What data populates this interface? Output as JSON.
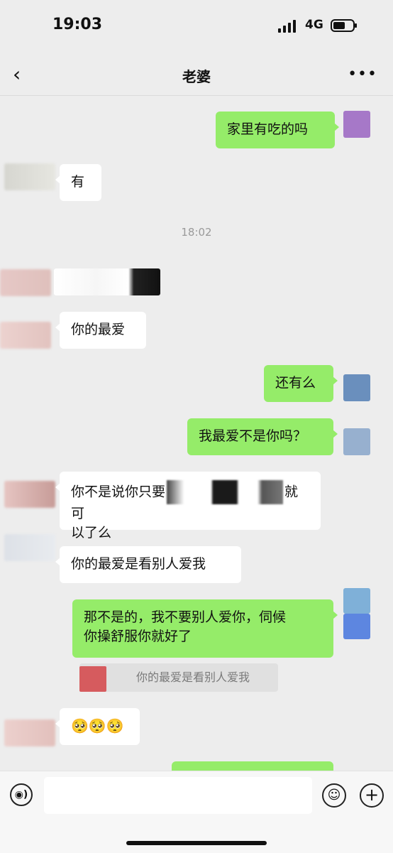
{
  "status": {
    "time": "19:03",
    "network": "4G"
  },
  "nav": {
    "back_icon": "‹",
    "title": "老婆",
    "more_icon": "•••"
  },
  "messages": [
    {
      "side": "right",
      "text": "家里有吃的吗"
    },
    {
      "side": "left",
      "text": "有"
    },
    {
      "side": "left",
      "text": "你的最爱"
    },
    {
      "side": "right",
      "text": "还有么"
    },
    {
      "side": "right",
      "text": "我最爱不是你吗？"
    },
    {
      "side": "left",
      "text": "你不是说你只要",
      "text_end": "就可",
      "text_line2": "以了么"
    },
    {
      "side": "left",
      "text": "你的最爱是看别人爱我"
    },
    {
      "side": "right",
      "text_line1": "那不是的，我不要别人爱你，伺候",
      "text_line2": "你操舒服你就好了"
    },
    {
      "side": "left",
      "text": "🥺🥺🥺"
    }
  ],
  "timestamp": "18:02",
  "quote": {
    "text": "你的最爱是看别人爱我"
  },
  "input": {
    "voice_icon": "◉)",
    "emoji_icon": "☺",
    "plus_icon": "+"
  },
  "colors": {
    "background": "#ededed",
    "bubble_right": "#95ec69",
    "bubble_left": "#ffffff"
  }
}
